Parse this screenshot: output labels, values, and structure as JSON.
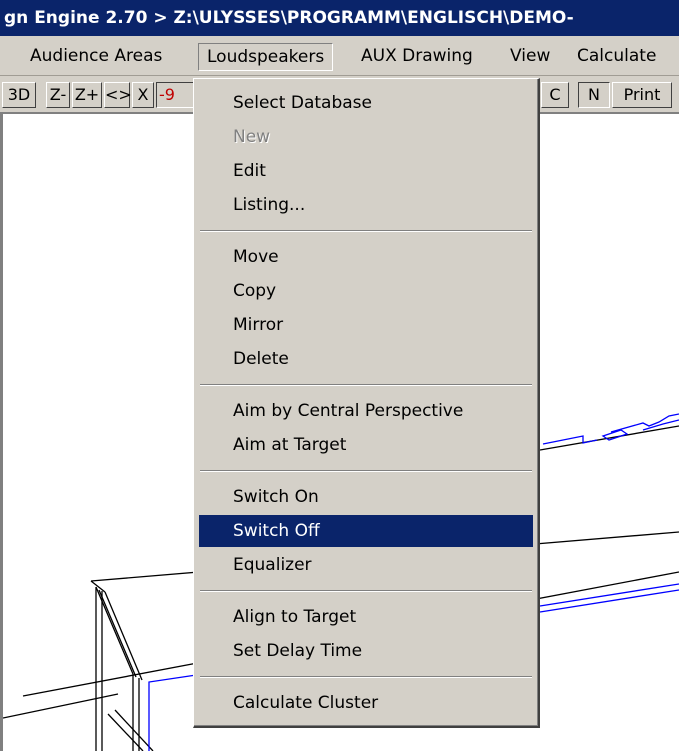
{
  "title": "gn Engine 2.70 > Z:\\ULYSSES\\PROGRAMM\\ENGLISCH\\DEMO-",
  "menubar": [
    {
      "label": "Audience Areas",
      "open": false
    },
    {
      "label": "Loudspeakers",
      "open": true
    },
    {
      "label": "AUX Drawing",
      "open": false
    },
    {
      "label": "View",
      "open": false
    },
    {
      "label": "Calculate",
      "open": false
    }
  ],
  "toolbar": {
    "left": [
      "3D",
      "Z-",
      "Z+",
      "<>",
      "X",
      "-9"
    ],
    "right": [
      "C",
      "N",
      "Print"
    ]
  },
  "dropdown": [
    [
      {
        "label": "Select Database",
        "state": "normal"
      },
      {
        "label": "New",
        "state": "disabled"
      },
      {
        "label": "Edit",
        "state": "normal"
      },
      {
        "label": "Listing...",
        "state": "normal"
      }
    ],
    [
      {
        "label": "Move",
        "state": "normal"
      },
      {
        "label": "Copy",
        "state": "normal"
      },
      {
        "label": "Mirror",
        "state": "normal"
      },
      {
        "label": "Delete",
        "state": "normal"
      }
    ],
    [
      {
        "label": "Aim by Central Perspective",
        "state": "normal"
      },
      {
        "label": "Aim at Target",
        "state": "normal"
      }
    ],
    [
      {
        "label": "Switch On",
        "state": "normal"
      },
      {
        "label": "Switch Off",
        "state": "selected"
      },
      {
        "label": "Equalizer",
        "state": "normal"
      }
    ],
    [
      {
        "label": "Align to Target",
        "state": "normal"
      },
      {
        "label": "Set Delay Time",
        "state": "normal"
      }
    ],
    [
      {
        "label": "Calculate Cluster",
        "state": "normal"
      }
    ]
  ],
  "colors": {
    "title_bg": "#0a246a",
    "menu_bg": "#d4d0c8",
    "highlight": "#0a246a",
    "drawing_blue": "#0000ff",
    "drawing_black": "#000000"
  }
}
